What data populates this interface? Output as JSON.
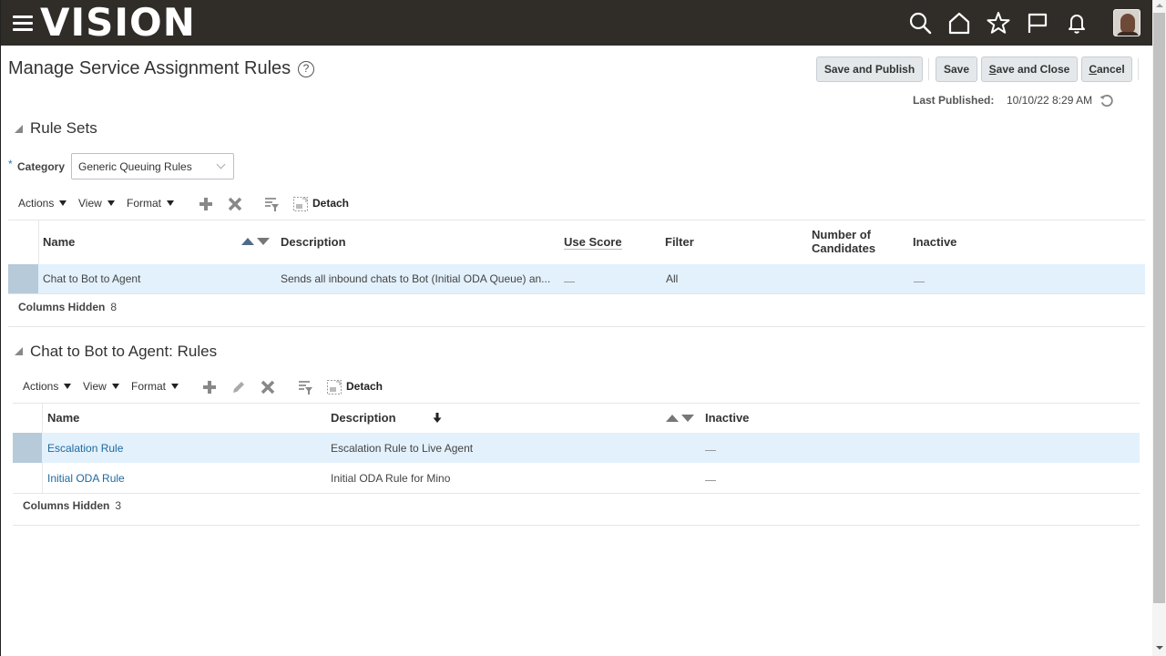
{
  "app": {
    "logo": "VISION",
    "header_icons": [
      "search-icon",
      "home-icon",
      "favorites-star-icon",
      "flag-icon",
      "notifications-bell-icon"
    ],
    "avatar": "user-avatar"
  },
  "page": {
    "title": "Manage Service Assignment Rules",
    "help_icon_glyph": "?",
    "buttons": {
      "save_publish": "Save and Publish",
      "save": "Save",
      "save_close": "Save and Close",
      "save_close_access_key": "S",
      "save_close_rest": "ave and Close",
      "cancel": "Cancel",
      "cancel_access_key": "C",
      "cancel_rest": "ancel"
    },
    "last_published_label": "Last Published:",
    "last_published_value": "10/10/22 8:29 AM"
  },
  "rule_sets": {
    "title": "Rule Sets",
    "category_label": "Category",
    "category_required": "*",
    "category_value": "Generic Queuing Rules",
    "toolbar": {
      "actions": "Actions",
      "view": "View",
      "format": "Format",
      "detach": "Detach"
    },
    "columns": [
      "Name",
      "Description",
      "Use Score",
      "Filter",
      "Number of",
      "Candidates",
      "Inactive"
    ],
    "rows": [
      {
        "name": "Chat to Bot to Agent",
        "description": "Sends all inbound chats to Bot (Initial ODA Queue) an...",
        "use_score": "—",
        "filter": "All",
        "number_of_candidates": "",
        "inactive": "—",
        "selected": true
      }
    ],
    "columns_hidden_label": "Columns Hidden",
    "columns_hidden_count": "8"
  },
  "rules": {
    "title": "Chat to Bot to Agent: Rules",
    "toolbar": {
      "actions": "Actions",
      "view": "View",
      "format": "Format",
      "detach": "Detach"
    },
    "columns": [
      "Name",
      "Description",
      "Inactive"
    ],
    "rows": [
      {
        "name": "Escalation Rule",
        "description": "Escalation Rule to Live Agent",
        "inactive": "—",
        "selected": true
      },
      {
        "name": "Initial ODA Rule",
        "description": "Initial ODA Rule for Mino",
        "inactive": "—",
        "selected": false
      }
    ],
    "columns_hidden_label": "Columns Hidden",
    "columns_hidden_count": "3"
  },
  "colors": {
    "header_bg": "#302c28",
    "selected_row": "#e3f1fc",
    "link": "#1d6aa0",
    "button_bg": "#e4e8ea"
  }
}
